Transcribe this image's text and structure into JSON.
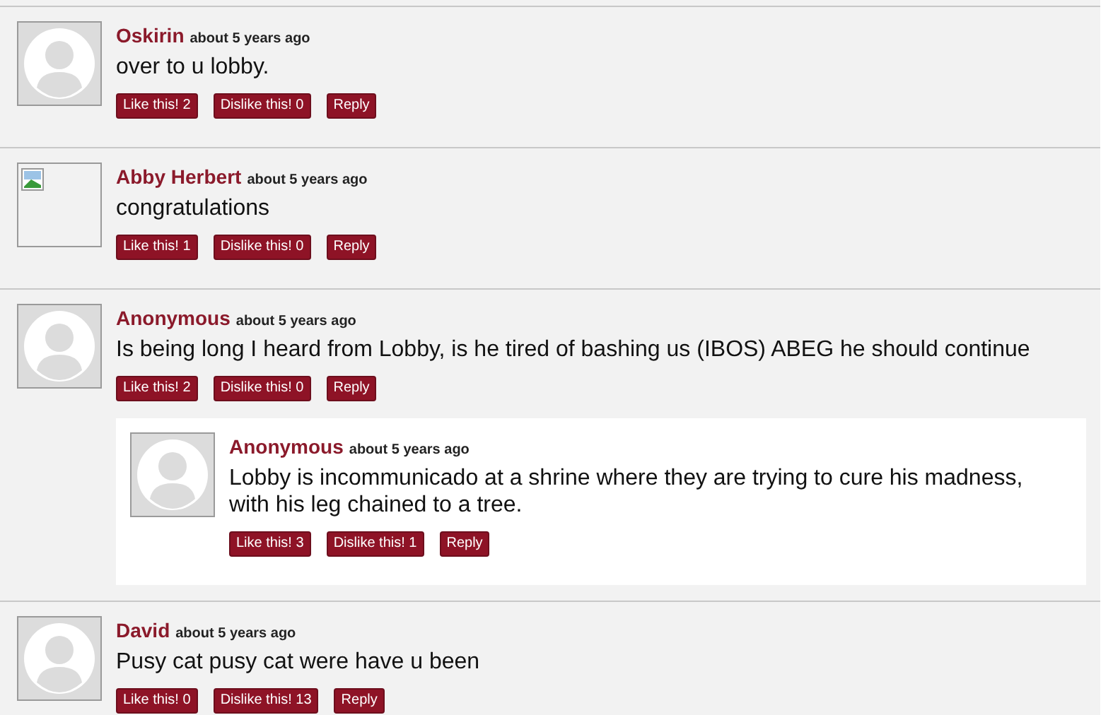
{
  "comments": [
    {
      "author": "Oskirin",
      "time": "about 5 years ago",
      "text": "over to u lobby.",
      "avatar": {
        "kind": "silhouette"
      },
      "like": "Like this! 2",
      "dislike": "Dislike this! 0",
      "reply": "Reply"
    },
    {
      "author": "Abby Herbert",
      "time": "about 5 years ago",
      "text": "congratulations",
      "avatar": {
        "kind": "broken"
      },
      "like": "Like this! 1",
      "dislike": "Dislike this! 0",
      "reply": "Reply"
    },
    {
      "author": "Anonymous",
      "time": "about 5 years ago",
      "text": "Is being long I heard from Lobby, is he tired of bashing us (IBOS) ABEG he should continue",
      "avatar": {
        "kind": "silhouette"
      },
      "like": "Like this! 2",
      "dislike": "Dislike this! 0",
      "reply": "Reply",
      "replies": [
        {
          "author": "Anonymous",
          "time": "about 5 years ago",
          "text": "Lobby is incommunicado at a shrine where they are trying to cure his madness, with his leg chained to a tree.",
          "avatar": {
            "kind": "silhouette"
          },
          "like": "Like this! 3",
          "dislike": "Dislike this! 1",
          "reply": "Reply"
        }
      ]
    },
    {
      "author": "David",
      "time": "about 5 years ago",
      "text": "Pusy cat pusy cat were have u been",
      "avatar": {
        "kind": "silhouette"
      },
      "like": "Like this! 0",
      "dislike": "Dislike this! 13",
      "reply": "Reply"
    }
  ]
}
